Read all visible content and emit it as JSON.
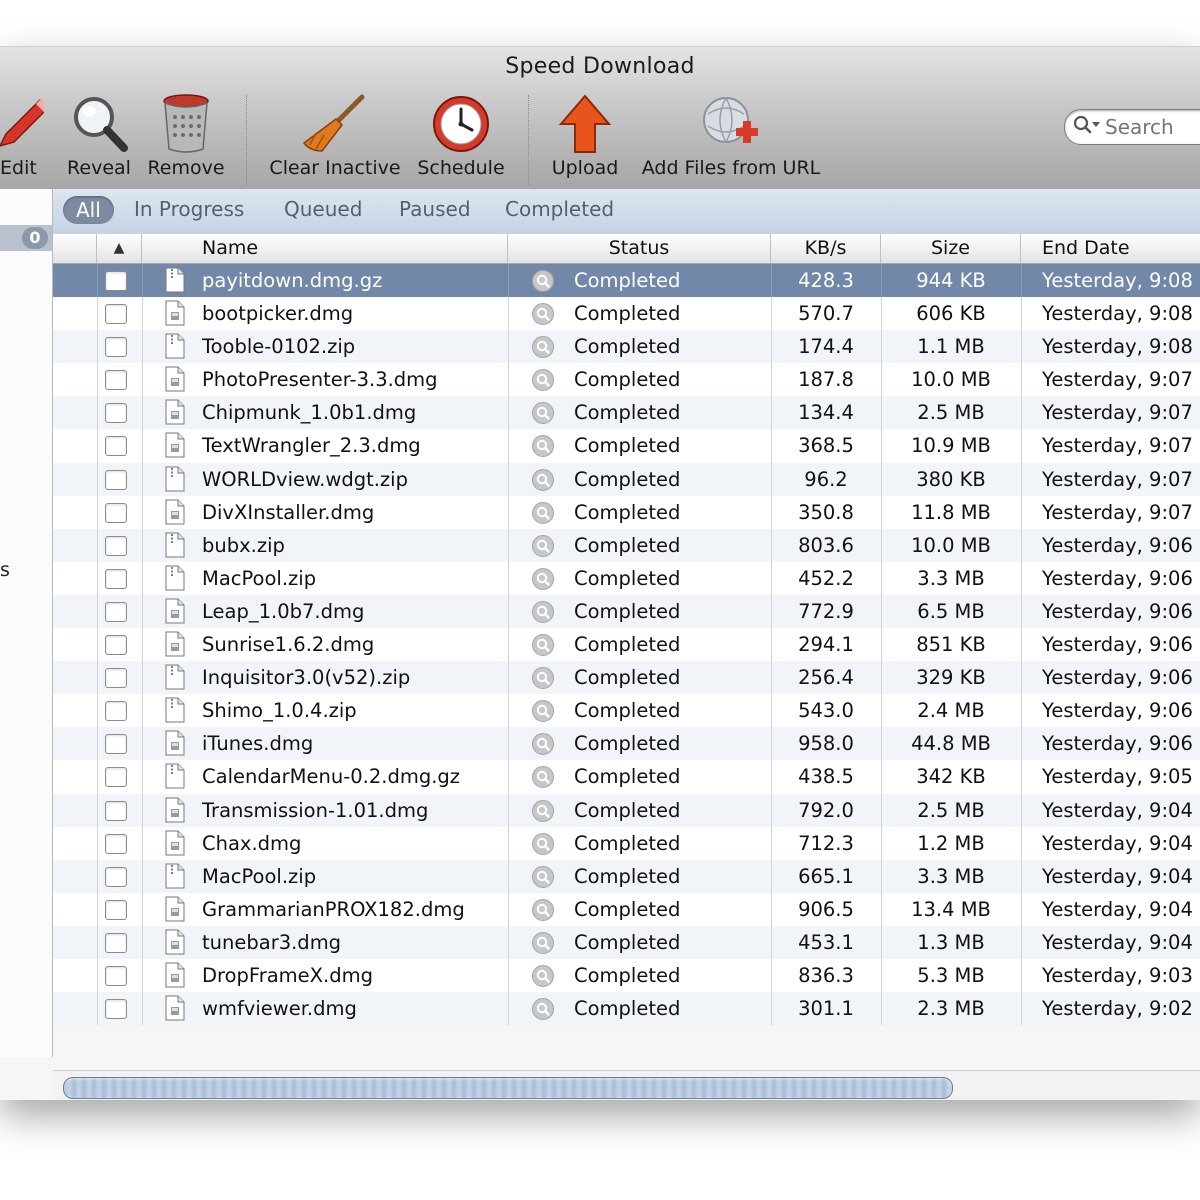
{
  "window": {
    "title": "Speed Download"
  },
  "toolbar": {
    "edit": "Edit",
    "reveal": "Reveal",
    "remove": "Remove",
    "clear_inactive": "Clear Inactive",
    "schedule": "Schedule",
    "upload": "Upload",
    "add_from_url": "Add Files from URL"
  },
  "search": {
    "placeholder": "Search"
  },
  "sidebar": {
    "badge_count": "0",
    "partial_label": "s"
  },
  "filters": [
    "All",
    "In Progress",
    "Queued",
    "Paused",
    "Completed"
  ],
  "columns": {
    "name": "Name",
    "status": "Status",
    "speed": "KB/s",
    "size": "Size",
    "end_date": "End Date"
  },
  "rows": [
    {
      "name": "payitdown.dmg.gz",
      "status": "Completed",
      "speed": "428.3",
      "size": "944 KB",
      "end": "Yesterday, 9:08",
      "icon": "zip"
    },
    {
      "name": "bootpicker.dmg",
      "status": "Completed",
      "speed": "570.7",
      "size": "606 KB",
      "end": "Yesterday, 9:08",
      "icon": "dmg"
    },
    {
      "name": "Tooble-0102.zip",
      "status": "Completed",
      "speed": "174.4",
      "size": "1.1 MB",
      "end": "Yesterday, 9:08",
      "icon": "zip"
    },
    {
      "name": "PhotoPresenter-3.3.dmg",
      "status": "Completed",
      "speed": "187.8",
      "size": "10.0 MB",
      "end": "Yesterday, 9:07",
      "icon": "dmg"
    },
    {
      "name": "Chipmunk_1.0b1.dmg",
      "status": "Completed",
      "speed": "134.4",
      "size": "2.5 MB",
      "end": "Yesterday, 9:07",
      "icon": "dmg"
    },
    {
      "name": "TextWrangler_2.3.dmg",
      "status": "Completed",
      "speed": "368.5",
      "size": "10.9 MB",
      "end": "Yesterday, 9:07",
      "icon": "dmg"
    },
    {
      "name": "WORLDview.wdgt.zip",
      "status": "Completed",
      "speed": "96.2",
      "size": "380 KB",
      "end": "Yesterday, 9:07",
      "icon": "zip"
    },
    {
      "name": "DivXInstaller.dmg",
      "status": "Completed",
      "speed": "350.8",
      "size": "11.8 MB",
      "end": "Yesterday, 9:07",
      "icon": "dmg"
    },
    {
      "name": "bubx.zip",
      "status": "Completed",
      "speed": "803.6",
      "size": "10.0 MB",
      "end": "Yesterday, 9:06",
      "icon": "zip"
    },
    {
      "name": "MacPool.zip",
      "status": "Completed",
      "speed": "452.2",
      "size": "3.3 MB",
      "end": "Yesterday, 9:06",
      "icon": "zip"
    },
    {
      "name": "Leap_1.0b7.dmg",
      "status": "Completed",
      "speed": "772.9",
      "size": "6.5 MB",
      "end": "Yesterday, 9:06",
      "icon": "dmg"
    },
    {
      "name": "Sunrise1.6.2.dmg",
      "status": "Completed",
      "speed": "294.1",
      "size": "851 KB",
      "end": "Yesterday, 9:06",
      "icon": "dmg"
    },
    {
      "name": "Inquisitor3.0(v52).zip",
      "status": "Completed",
      "speed": "256.4",
      "size": "329 KB",
      "end": "Yesterday, 9:06",
      "icon": "zip"
    },
    {
      "name": "Shimo_1.0.4.zip",
      "status": "Completed",
      "speed": "543.0",
      "size": "2.4 MB",
      "end": "Yesterday, 9:06",
      "icon": "zip"
    },
    {
      "name": "iTunes.dmg",
      "status": "Completed",
      "speed": "958.0",
      "size": "44.8 MB",
      "end": "Yesterday, 9:06",
      "icon": "dmg"
    },
    {
      "name": "CalendarMenu-0.2.dmg.gz",
      "status": "Completed",
      "speed": "438.5",
      "size": "342 KB",
      "end": "Yesterday, 9:05",
      "icon": "zip"
    },
    {
      "name": "Transmission-1.01.dmg",
      "status": "Completed",
      "speed": "792.0",
      "size": "2.5 MB",
      "end": "Yesterday, 9:04",
      "icon": "dmg"
    },
    {
      "name": "Chax.dmg",
      "status": "Completed",
      "speed": "712.3",
      "size": "1.2 MB",
      "end": "Yesterday, 9:04",
      "icon": "dmg"
    },
    {
      "name": "MacPool.zip",
      "status": "Completed",
      "speed": "665.1",
      "size": "3.3 MB",
      "end": "Yesterday, 9:04",
      "icon": "zip"
    },
    {
      "name": "GrammarianPROX182.dmg",
      "status": "Completed",
      "speed": "906.5",
      "size": "13.4 MB",
      "end": "Yesterday, 9:04",
      "icon": "dmg"
    },
    {
      "name": "tunebar3.dmg",
      "status": "Completed",
      "speed": "453.1",
      "size": "1.3 MB",
      "end": "Yesterday, 9:04",
      "icon": "dmg"
    },
    {
      "name": "DropFrameX.dmg",
      "status": "Completed",
      "speed": "836.3",
      "size": "5.3 MB",
      "end": "Yesterday, 9:03",
      "icon": "dmg"
    },
    {
      "name": "wmfviewer.dmg",
      "status": "Completed",
      "speed": "301.1",
      "size": "2.3 MB",
      "end": "Yesterday, 9:02",
      "icon": "dmg"
    }
  ],
  "selected_row": 0,
  "colors": {
    "selection": "#7288a8",
    "filter_active": "#7d8ba0",
    "stripe": "#f1f4f8"
  }
}
